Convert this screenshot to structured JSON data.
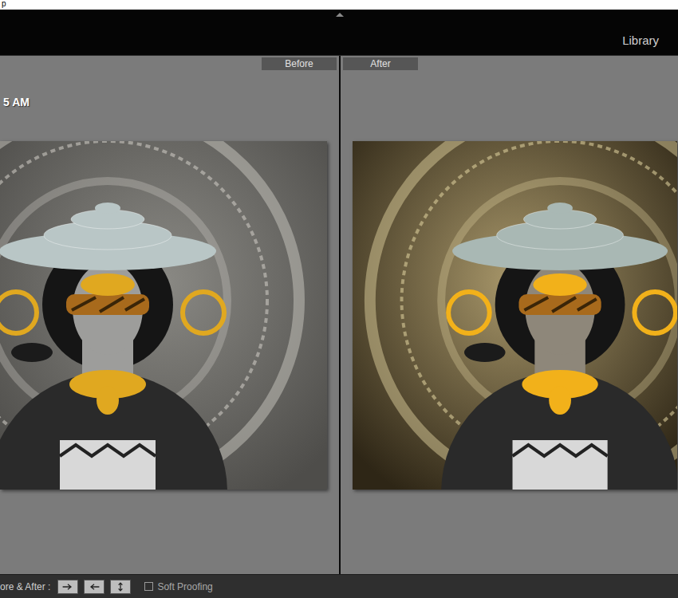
{
  "top_strip": {
    "text": "p"
  },
  "header": {
    "module": "Library"
  },
  "views": [
    {
      "label": "Before",
      "caption": "5 AM",
      "tone": "before"
    },
    {
      "label": "After",
      "tone": "after"
    }
  ],
  "toolbar": {
    "label": "ore & After :",
    "soft_proofing": {
      "label": "Soft Proofing",
      "checked": false
    }
  }
}
